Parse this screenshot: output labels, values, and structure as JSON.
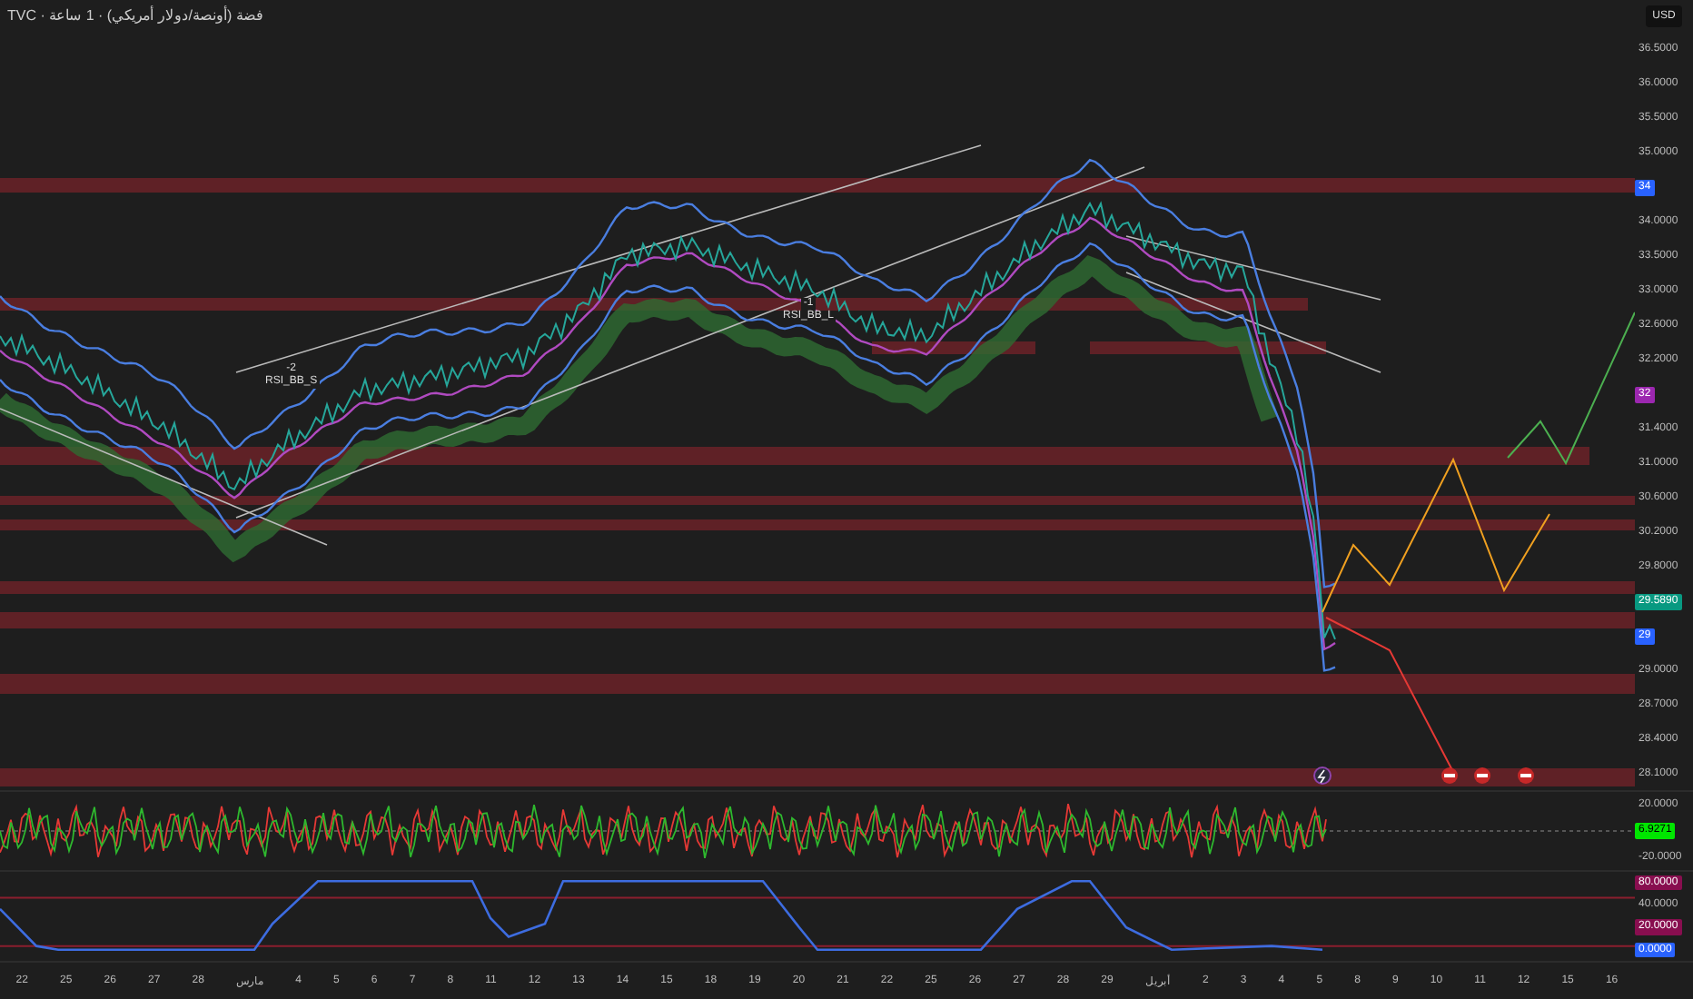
{
  "header": {
    "title": "TVC · فضة (أونصة/دولار أمريكي) · 1 ساعة"
  },
  "currency": "USD",
  "signals": [
    {
      "value": "-2",
      "name": "RSI_BB_S"
    },
    {
      "value": "-1",
      "name": "RSI_BB_L"
    }
  ],
  "price_axis": [
    {
      "kind": "tick",
      "text": "36.5000"
    },
    {
      "kind": "tick",
      "text": "36.0000"
    },
    {
      "kind": "tick",
      "text": "35.5000"
    },
    {
      "kind": "tick",
      "text": "35.0000"
    },
    {
      "kind": "tag",
      "text": "34",
      "color": "#2962ff"
    },
    {
      "kind": "tick",
      "text": "34.0000"
    },
    {
      "kind": "tick",
      "text": "33.5000"
    },
    {
      "kind": "tick",
      "text": "33.0000"
    },
    {
      "kind": "tick",
      "text": "32.6000"
    },
    {
      "kind": "tick",
      "text": "32.2000"
    },
    {
      "kind": "tag",
      "text": "32",
      "color": "#9c27b0"
    },
    {
      "kind": "tick",
      "text": "31.4000"
    },
    {
      "kind": "tick",
      "text": "31.0000"
    },
    {
      "kind": "tick",
      "text": "30.6000"
    },
    {
      "kind": "tick",
      "text": "30.2000"
    },
    {
      "kind": "tick",
      "text": "29.8000"
    },
    {
      "kind": "tag",
      "text": "29.5890",
      "color": "#089981"
    },
    {
      "kind": "tag",
      "text": "29",
      "color": "#2962ff"
    },
    {
      "kind": "tick",
      "text": "29.0000"
    },
    {
      "kind": "tick",
      "text": "28.7000"
    },
    {
      "kind": "tick",
      "text": "28.4000"
    },
    {
      "kind": "tick",
      "text": "28.1000"
    }
  ],
  "oscillator_axis": [
    {
      "kind": "tick",
      "text": "20.0000"
    },
    {
      "kind": "tag",
      "text": "6.9271",
      "color": "#00e600"
    },
    {
      "kind": "tick",
      "text": "-20.0000"
    }
  ],
  "lower_axis": [
    {
      "kind": "tag",
      "text": "80.0000",
      "color": "#880e4f"
    },
    {
      "kind": "tick",
      "text": "40.0000"
    },
    {
      "kind": "tag",
      "text": "20.0000",
      "color": "#880e4f"
    },
    {
      "kind": "tag",
      "text": "0.0000",
      "color": "#2962ff"
    }
  ],
  "time_axis": [
    "22",
    "25",
    "26",
    "27",
    "28",
    "مارس",
    "4",
    "5",
    "6",
    "7",
    "8",
    "11",
    "12",
    "13",
    "14",
    "15",
    "18",
    "19",
    "20",
    "21",
    "22",
    "25",
    "26",
    "27",
    "28",
    "29",
    "أبريل",
    "2",
    "3",
    "4",
    "5",
    "8",
    "9",
    "10",
    "11",
    "12",
    "15",
    "16"
  ]
}
